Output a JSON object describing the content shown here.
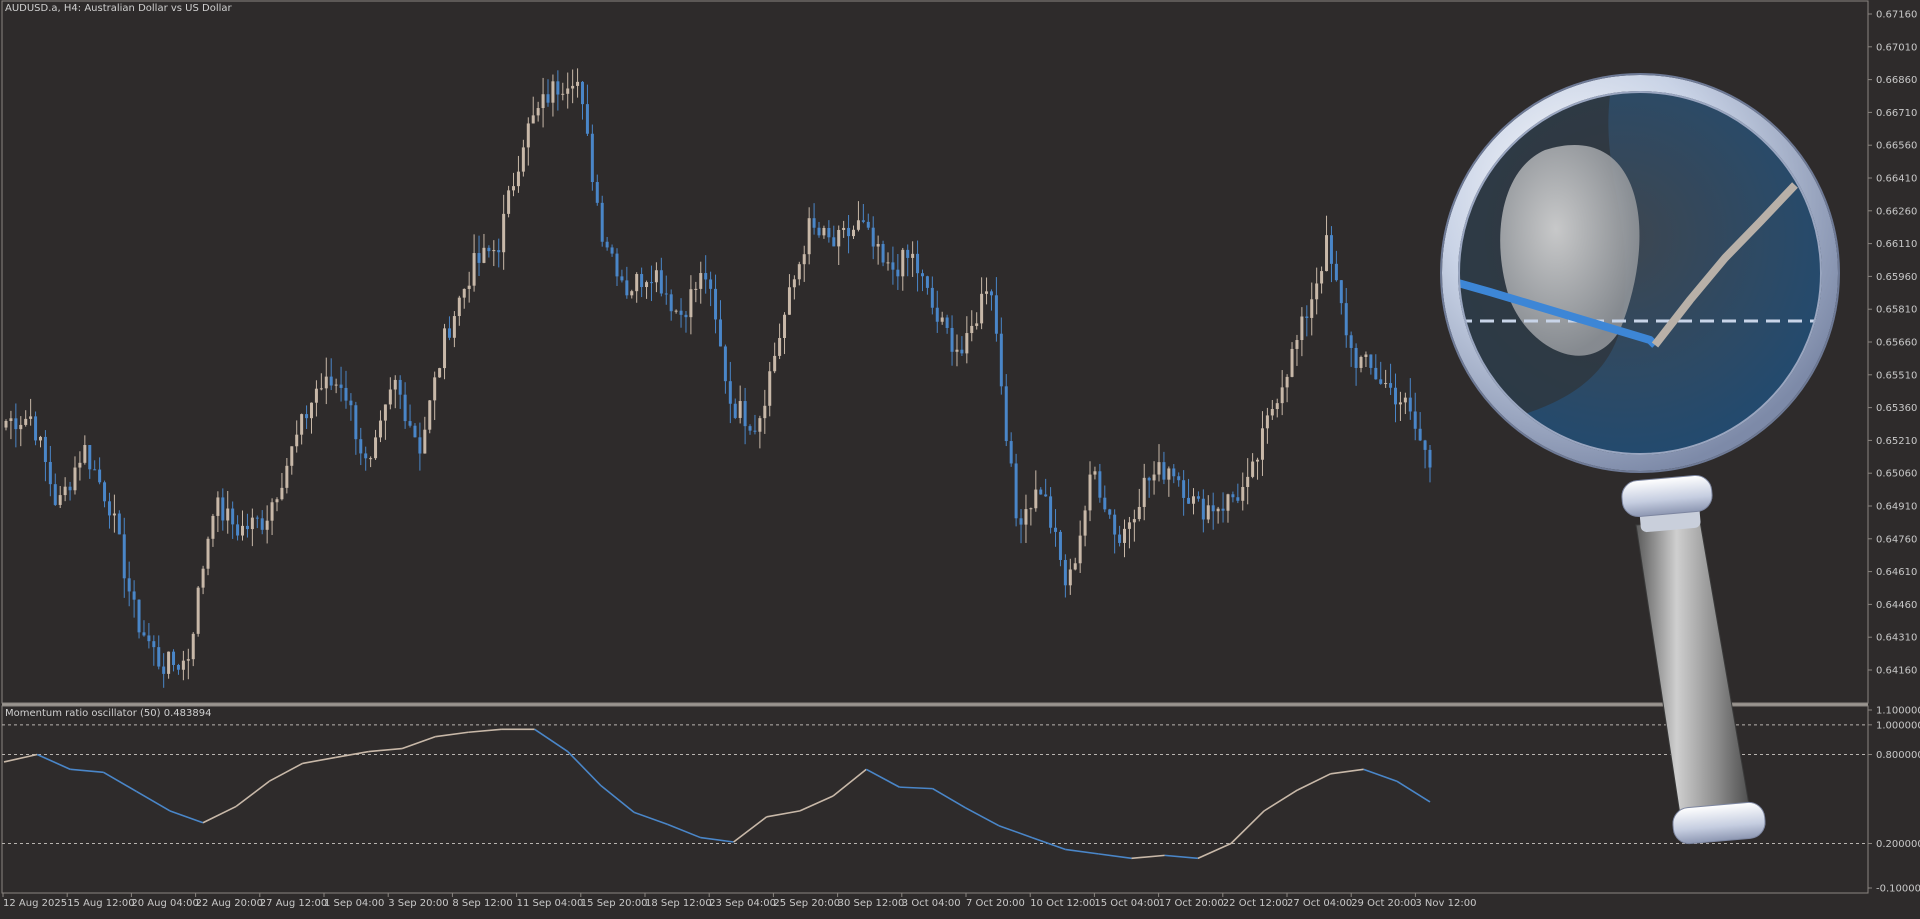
{
  "main_chart": {
    "title": "AUDUSD.a, H4:  Australian Dollar vs US Dollar",
    "price_axis": [
      "0.67160",
      "0.67010",
      "0.66860",
      "0.66710",
      "0.66560",
      "0.66410",
      "0.66260",
      "0.66110",
      "0.65960",
      "0.65810",
      "0.65660",
      "0.65510",
      "0.65360",
      "0.65210",
      "0.65060",
      "0.64910",
      "0.64760",
      "0.64610",
      "0.64460",
      "0.64310",
      "0.64160"
    ],
    "bull_color": "#c8b8a8",
    "bear_color": "#4a86c8",
    "background": "#2e2b2b"
  },
  "indicator": {
    "title": "Momentum ratio oscillator (50) 0.483894",
    "levels": [
      "1.100000",
      "1.000000",
      "0.800000",
      "0.200000",
      "-0.100000"
    ]
  },
  "time_axis": [
    "12 Aug 2025",
    "15 Aug 12:00",
    "20 Aug 04:00",
    "22 Aug 20:00",
    "27 Aug 12:00",
    "1 Sep 04:00",
    "3 Sep 20:00",
    "8 Sep 12:00",
    "11 Sep 04:00",
    "15 Sep 20:00",
    "18 Sep 12:00",
    "23 Sep 04:00",
    "25 Sep 20:00",
    "30 Sep 12:00",
    "3 Oct 04:00",
    "7 Oct 20:00",
    "10 Oct 12:00",
    "15 Oct 04:00",
    "17 Oct 20:00",
    "22 Oct 12:00",
    "27 Oct 04:00",
    "29 Oct 20:00",
    "3 Nov 12:00"
  ],
  "overlay": {
    "icon": "magnifying-glass-icon"
  },
  "chart_data": [
    {
      "type": "candlestick",
      "title": "AUDUSD.a, H4:  Australian Dollar vs US Dollar",
      "ylim": [
        0.6411,
        0.6721
      ],
      "x": [
        "12 Aug 2025",
        "15 Aug 12:00",
        "20 Aug 04:00",
        "22 Aug 20:00",
        "27 Aug 12:00",
        "1 Sep 04:00",
        "3 Sep 20:00",
        "8 Sep 12:00",
        "11 Sep 04:00",
        "15 Sep 20:00",
        "18 Sep 12:00",
        "23 Sep 04:00",
        "25 Sep 20:00",
        "30 Sep 12:00",
        "3 Oct 04:00",
        "7 Oct 20:00",
        "10 Oct 12:00",
        "15 Oct 04:00",
        "17 Oct 20:00",
        "22 Oct 12:00",
        "27 Oct 04:00",
        "29 Oct 20:00",
        "3 Nov 12:00"
      ],
      "close_path": [
        0.653,
        0.6532,
        0.649,
        0.6518,
        0.6492,
        0.644,
        0.6418,
        0.642,
        0.6492,
        0.648,
        0.6485,
        0.6515,
        0.6545,
        0.6548,
        0.6505,
        0.6548,
        0.6518,
        0.657,
        0.66,
        0.661,
        0.666,
        0.668,
        0.669,
        0.6618,
        0.659,
        0.66,
        0.6578,
        0.6598,
        0.6538,
        0.6528,
        0.6575,
        0.6618,
        0.661,
        0.662,
        0.6598,
        0.6605,
        0.6575,
        0.656,
        0.6598,
        0.6485,
        0.65,
        0.6452,
        0.6508,
        0.6475,
        0.6502,
        0.651,
        0.649,
        0.6492,
        0.65,
        0.654,
        0.657,
        0.661,
        0.656,
        0.655,
        0.6538,
        0.651
      ],
      "colors": {
        "up": "#c8b8a8",
        "down": "#4a86c8"
      }
    },
    {
      "type": "line",
      "title": "Momentum ratio oscillator (50) 0.483894",
      "ylim": [
        -0.1,
        1.1
      ],
      "levels": [
        1.0,
        0.8,
        0.2
      ],
      "x": [
        "12 Aug 2025",
        "15 Aug 12:00",
        "20 Aug 04:00",
        "22 Aug 20:00",
        "27 Aug 12:00",
        "1 Sep 04:00",
        "3 Sep 20:00",
        "8 Sep 12:00",
        "11 Sep 04:00",
        "15 Sep 20:00",
        "18 Sep 12:00",
        "23 Sep 04:00",
        "25 Sep 20:00",
        "30 Sep 12:00",
        "3 Oct 04:00",
        "7 Oct 20:00",
        "10 Oct 12:00",
        "15 Oct 04:00",
        "17 Oct 20:00",
        "22 Oct 12:00",
        "27 Oct 04:00",
        "29 Oct 20:00",
        "3 Nov 12:00"
      ],
      "values": [
        0.75,
        0.8,
        0.7,
        0.68,
        0.55,
        0.42,
        0.34,
        0.45,
        0.62,
        0.74,
        0.78,
        0.82,
        0.84,
        0.92,
        0.95,
        0.97,
        0.97,
        0.82,
        0.59,
        0.41,
        0.33,
        0.24,
        0.21,
        0.38,
        0.42,
        0.52,
        0.7,
        0.58,
        0.57,
        0.44,
        0.32,
        0.24,
        0.16,
        0.13,
        0.1,
        0.12,
        0.1,
        0.2,
        0.42,
        0.56,
        0.67,
        0.7,
        0.62,
        0.48
      ],
      "colors": {
        "rising": "#c8b8a8",
        "falling": "#4a86c8"
      },
      "last_value": 0.483894
    }
  ]
}
